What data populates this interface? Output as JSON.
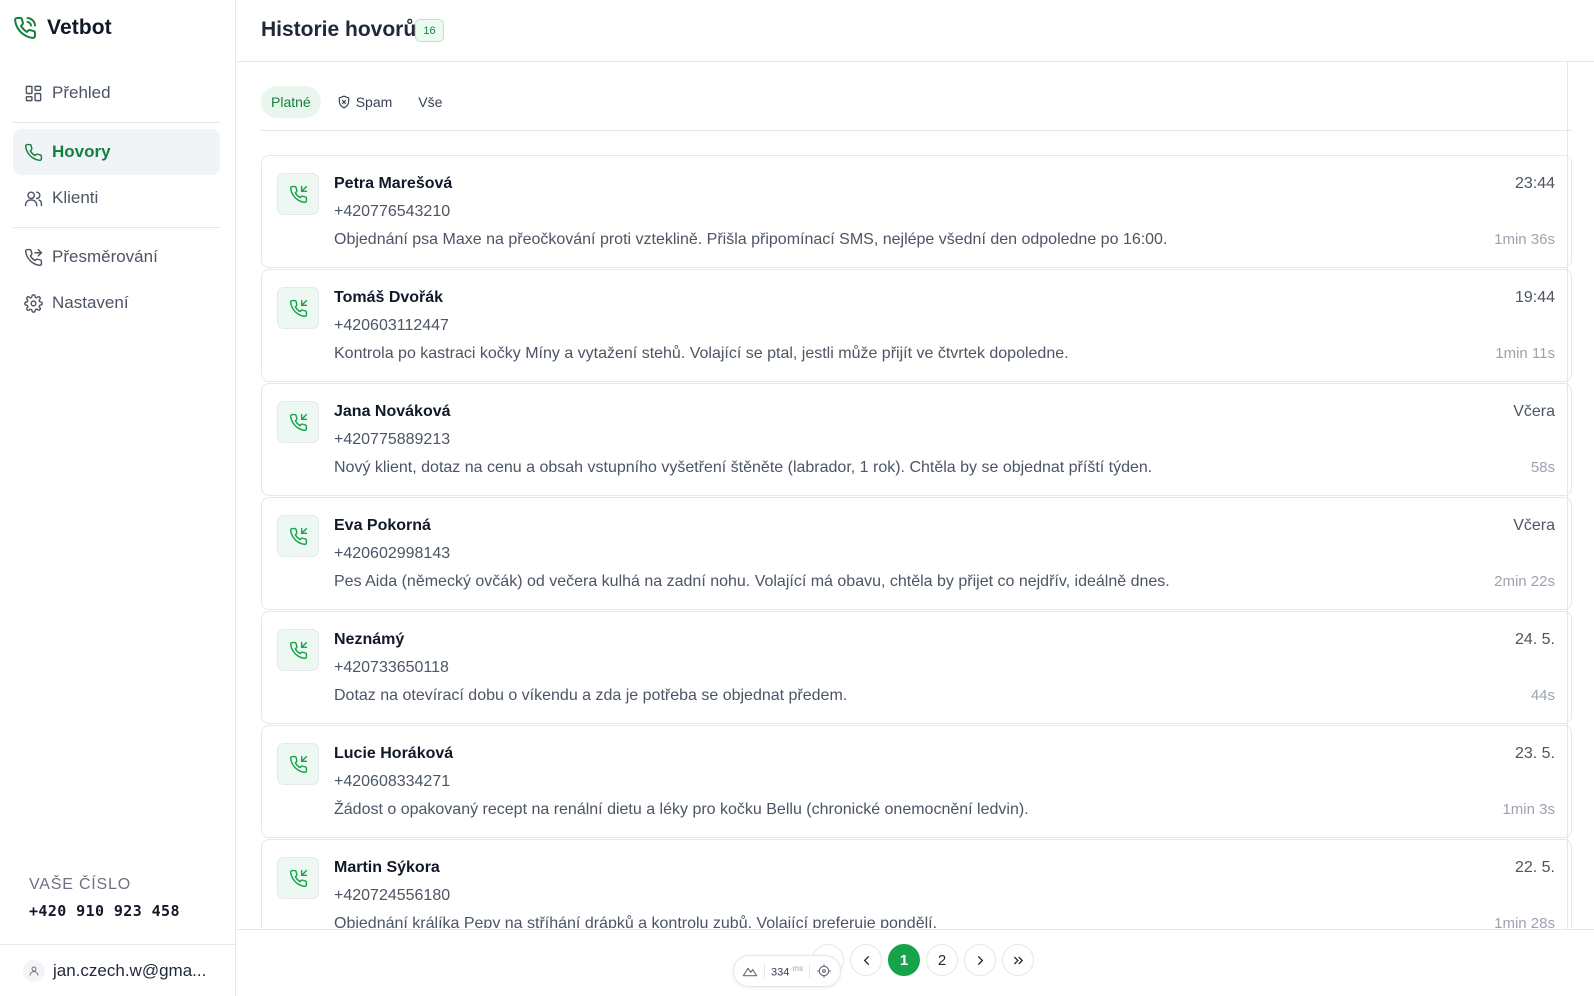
{
  "brand": {
    "name": "Vetbot",
    "icon": "phone-icon"
  },
  "sidebar": {
    "items": [
      {
        "label": "Přehled",
        "icon": "dashboard-icon",
        "active": false
      },
      {
        "label": "Hovory",
        "icon": "phone-icon",
        "active": true
      },
      {
        "label": "Klienti",
        "icon": "users-icon",
        "active": false
      },
      {
        "label": "Přesměrování",
        "icon": "phone-forward-icon",
        "active": false
      },
      {
        "label": "Nastavení",
        "icon": "gear-icon",
        "active": false
      }
    ],
    "number_label": "VAŠE ČÍSLO",
    "number_value": "+420 910 923 458",
    "user_email": "jan.czech.w@gma..."
  },
  "header": {
    "title": "Historie hovorů",
    "count": "16"
  },
  "tabs": [
    {
      "label": "Platné",
      "active": true
    },
    {
      "label": "Spam",
      "icon": "shield-icon",
      "active": false
    },
    {
      "label": "Vše",
      "active": false
    }
  ],
  "calls": [
    {
      "name": "Petra Marešová",
      "phone": "+420776543210",
      "summary": "Objednání psa Maxe na přeočkování proti vzteklině. Přišla připomínací SMS, nejlépe všední den odpoledne po 16:00.",
      "time": "23:44",
      "duration": "1min 36s"
    },
    {
      "name": "Tomáš Dvořák",
      "phone": "+420603112447",
      "summary": "Kontrola po kastraci kočky Míny a vytažení stehů. Volající se ptal, jestli může přijít ve čtvrtek dopoledne.",
      "time": "19:44",
      "duration": "1min 11s"
    },
    {
      "name": "Jana Nováková",
      "phone": "+420775889213",
      "summary": "Nový klient, dotaz na cenu a obsah vstupního vyšetření štěněte (labrador, 1 rok). Chtěla by se objednat příští týden.",
      "time": "Včera",
      "duration": "58s"
    },
    {
      "name": "Eva Pokorná",
      "phone": "+420602998143",
      "summary": "Pes Aida (německý ovčák) od večera kulhá na zadní nohu. Volající má obavu, chtěla by přijet co nejdřív, ideálně dnes.",
      "time": "Včera",
      "duration": "2min 22s"
    },
    {
      "name": "Neznámý",
      "phone": "+420733650118",
      "summary": "Dotaz na otevírací dobu o víkendu a zda je potřeba se objednat předem.",
      "time": "24. 5.",
      "duration": "44s"
    },
    {
      "name": "Lucie Horáková",
      "phone": "+420608334271",
      "summary": "Žádost o opakovaný recept na renální dietu a léky pro kočku Bellu (chronické onemocnění ledvin).",
      "time": "23. 5.",
      "duration": "1min 3s"
    },
    {
      "name": "Martin Sýkora",
      "phone": "+420724556180",
      "summary": "Objednání králíka Pepy na stříhání drápků a kontrolu zubů. Volající preferuje pondělí.",
      "time": "22. 5.",
      "duration": "1min 28s"
    }
  ],
  "pagination": {
    "pages": [
      "1",
      "2"
    ],
    "current": "1"
  },
  "perf": {
    "value": "334",
    "unit": "ms"
  },
  "colors": {
    "accent": "#16a34a",
    "accent_dark": "#15803d",
    "active_bg": "#f1f4f7"
  }
}
